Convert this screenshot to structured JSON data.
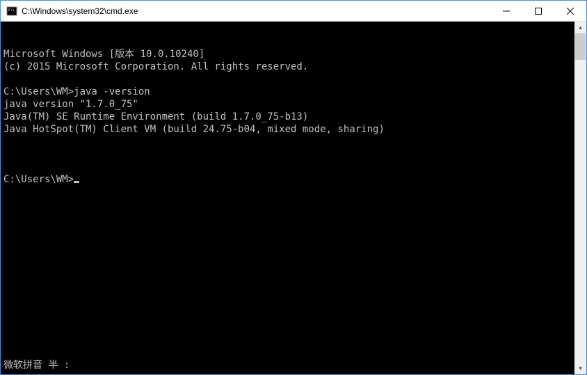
{
  "titlebar": {
    "title": "C:\\Windows\\system32\\cmd.exe"
  },
  "terminal": {
    "lines": [
      "Microsoft Windows [版本 10.0.10240]",
      "(c) 2015 Microsoft Corporation. All rights reserved.",
      "",
      "C:\\Users\\WM>java -version",
      "java version \"1.7.0_75\"",
      "Java(TM) SE Runtime Environment (build 1.7.0_75-b13)",
      "Java HotSpot(TM) Client VM (build 24.75-b04, mixed mode, sharing)",
      ""
    ],
    "prompt": "C:\\Users\\WM>",
    "ime_status": "微软拼音 半 :"
  }
}
